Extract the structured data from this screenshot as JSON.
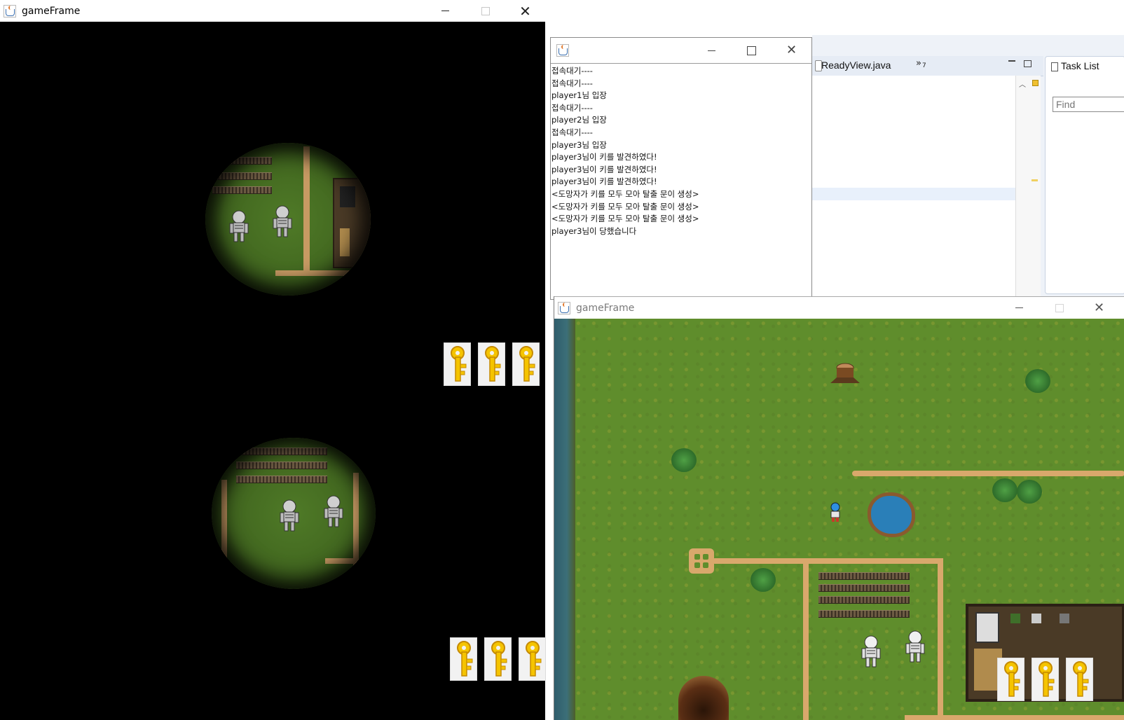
{
  "window_main": {
    "title": "gameFrame",
    "buttons": [
      "minimize",
      "maximize",
      "close"
    ],
    "keys_top_count": 3,
    "keys_bottom_count": 3
  },
  "log_window": {
    "title": "",
    "lines": [
      "접속대기----",
      "접속대기----",
      "player1님 입장",
      "접속대기----",
      "player2님 입장",
      "접속대기----",
      "player3님 입장",
      "player3님이 키를 발견하였다!",
      "player3님이 키를 발견하였다!",
      "player3님이 키를 발견하였다!",
      "<도망자가 키를 모두 모아 탈출 문이 생성>",
      "<도망자가 키를 모두 모아 탈출 문이 생성>",
      "<도망자가 키를 모두 모아 탈출 문이 생성>",
      "player3님이 당했습니다"
    ]
  },
  "eclipse": {
    "tab_file": "ReadyView.java",
    "tab_overflow": "»",
    "tab_overflow_count": "7",
    "task_list_label": "Task List",
    "find_placeholder": "Find"
  },
  "window_second": {
    "title": "gameFrame",
    "keys_count": 3
  },
  "icons": {
    "window_icon": "java-cup-icon",
    "key_icon": "golden-key-icon",
    "skeleton": "skeleton-sprite",
    "player": "player-sprite"
  },
  "colors": {
    "key_gold": "#f5c400",
    "grass": "#5c8a2a",
    "path": "#d9a86c",
    "pond": "#2a7fb8"
  }
}
